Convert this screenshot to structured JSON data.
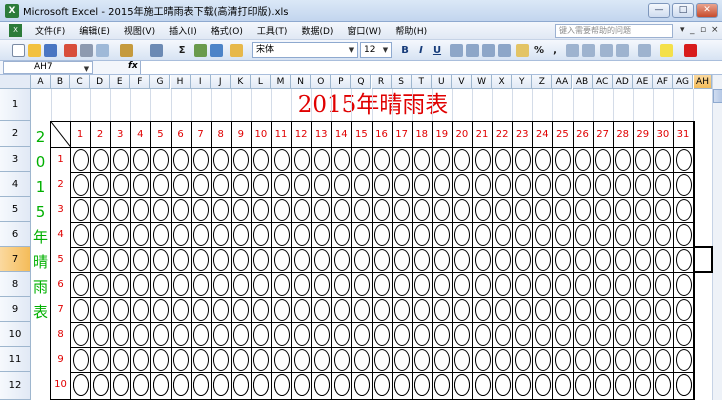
{
  "window": {
    "title": "Microsoft Excel - 2015年施工晴雨表下载(高清打印版).xls",
    "buttons": [
      "—",
      "□",
      "✕"
    ]
  },
  "menu": {
    "items": [
      "文件(F)",
      "编辑(E)",
      "视图(V)",
      "插入(I)",
      "格式(O)",
      "工具(T)",
      "数据(D)",
      "窗口(W)",
      "帮助(H)"
    ],
    "ask_placeholder": "键入需要帮助的问题",
    "window_controls": [
      "▾",
      "_",
      "▫",
      "×"
    ]
  },
  "toolbar": {
    "font_name": "宋体",
    "font_size": "12",
    "bold": "B",
    "italic": "I",
    "underline": "U",
    "percent": "%",
    "comma": ",",
    "sigma": "Σ"
  },
  "formula_bar": {
    "name_box": "AH7",
    "fx": "fx",
    "value": ""
  },
  "columns": [
    "A",
    "B",
    "C",
    "D",
    "E",
    "F",
    "G",
    "H",
    "I",
    "J",
    "K",
    "L",
    "M",
    "N",
    "O",
    "P",
    "Q",
    "R",
    "S",
    "T",
    "U",
    "V",
    "W",
    "X",
    "Y",
    "Z",
    "AA",
    "AB",
    "AC",
    "AD",
    "AE",
    "AF",
    "AG"
  ],
  "selected_column": "AH",
  "rows": [
    "1",
    "2",
    "3",
    "4",
    "5",
    "6",
    "7",
    "8",
    "9",
    "10",
    "11",
    "12"
  ],
  "selected_row": "7",
  "table": {
    "title": "2015年晴雨表",
    "vertical_title": [
      "2",
      "0",
      "1",
      "5",
      "年",
      "晴",
      "雨",
      "表"
    ],
    "days": [
      "1",
      "2",
      "3",
      "4",
      "5",
      "6",
      "7",
      "8",
      "9",
      "10",
      "11",
      "12",
      "13",
      "14",
      "15",
      "16",
      "17",
      "18",
      "19",
      "20",
      "21",
      "22",
      "23",
      "24",
      "25",
      "26",
      "27",
      "28",
      "29",
      "30",
      "31"
    ],
    "months": [
      "1",
      "2",
      "3",
      "4",
      "5",
      "6",
      "7",
      "8",
      "9",
      "10"
    ]
  },
  "colors": {
    "title_red": "#e00000",
    "vertical_green": "#00b000",
    "header_blue": "#e1e9f5",
    "selected_header": "#f4bc59"
  }
}
